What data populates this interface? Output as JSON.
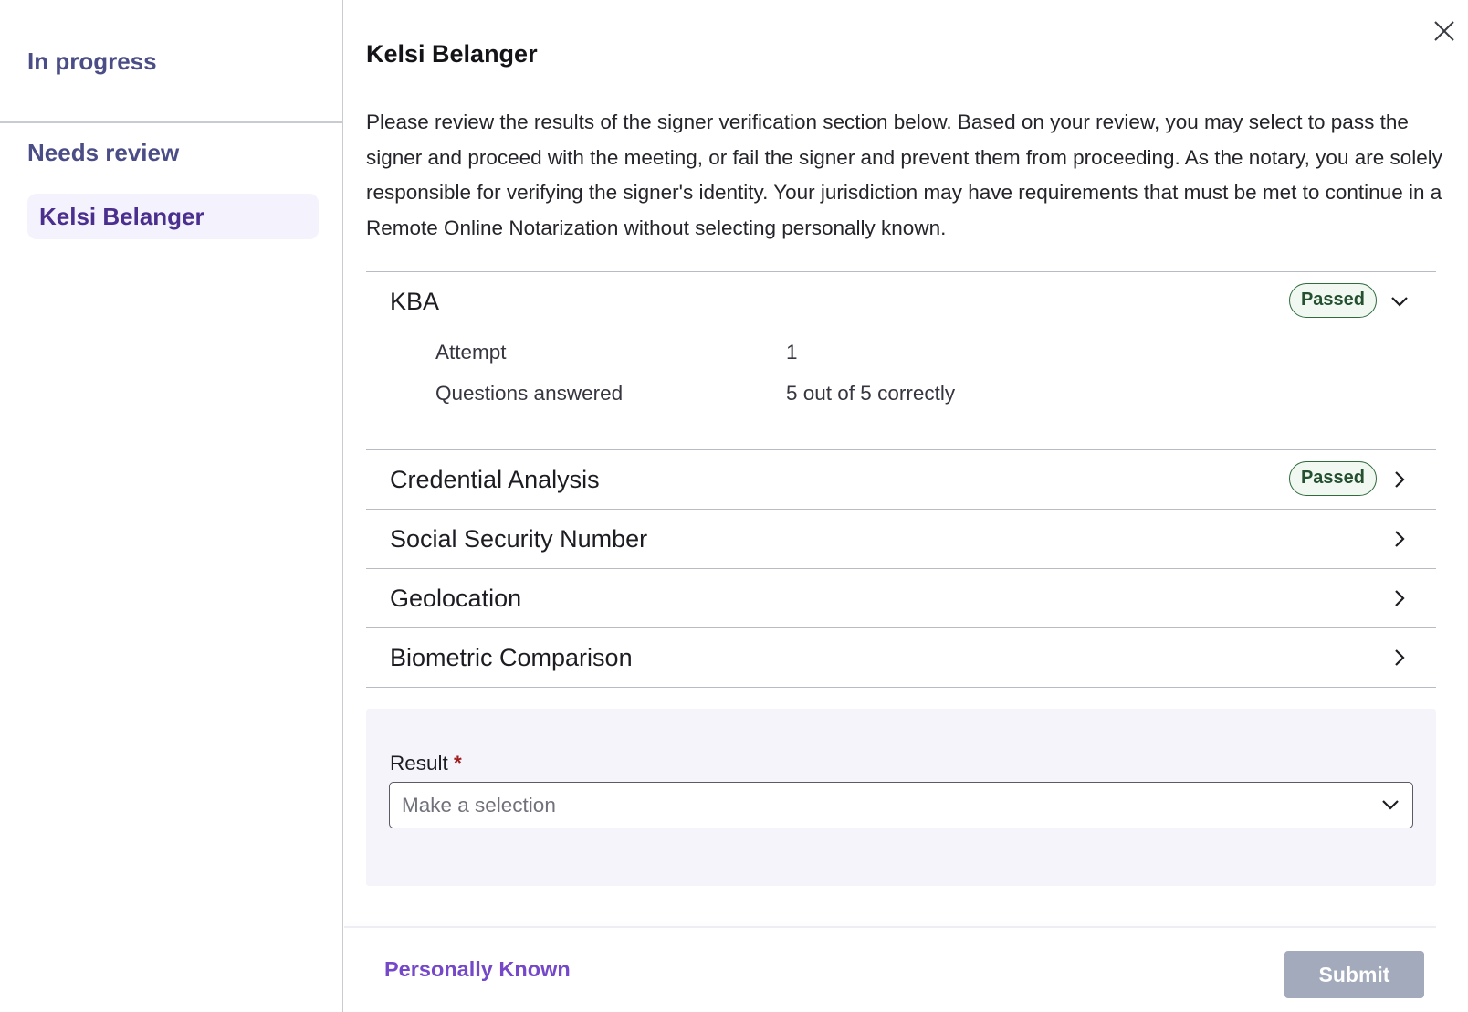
{
  "sidebar": {
    "sections": [
      {
        "title": "In progress",
        "items": []
      },
      {
        "title": "Needs review",
        "items": [
          {
            "label": "Kelsi Belanger",
            "selected": true
          }
        ]
      }
    ]
  },
  "modal": {
    "title": "Kelsi Belanger",
    "close_icon": "close-icon",
    "description": "Please review the results of the signer verification section below. Based on your review, you may select to pass the signer and proceed with the meeting, or fail the signer and prevent them from proceeding. As the notary, you are solely responsible for verifying the signer's identity. Your jurisdiction may have requirements that must be met to continue in a Remote Online Notarization without selecting personally known."
  },
  "sections": [
    {
      "title": "KBA",
      "badge": "Passed",
      "expanded": true,
      "details": [
        {
          "label": "Attempt",
          "value": "1"
        },
        {
          "label": "Questions answered",
          "value": "5 out of 5 correctly"
        }
      ]
    },
    {
      "title": "Credential Analysis",
      "badge": "Passed",
      "expanded": false
    },
    {
      "title": "Social Security Number",
      "badge": null,
      "expanded": false
    },
    {
      "title": "Geolocation",
      "badge": null,
      "expanded": false
    },
    {
      "title": "Biometric Comparison",
      "badge": null,
      "expanded": false
    }
  ],
  "result": {
    "label": "Result",
    "required_marker": "*",
    "placeholder": "Make a selection"
  },
  "footer": {
    "personally_known_label": "Personally Known",
    "submit_label": "Submit",
    "submit_disabled": true
  },
  "colors": {
    "sidebar_heading": "#4b4d86",
    "selected_item_text": "#4b2f8f",
    "selected_item_bg": "#f4f2fc",
    "badge_border": "#2f6b3c",
    "link": "#7548c9",
    "submit_disabled_bg": "#a3aabb",
    "panel_bg": "#f5f4fb",
    "required": "#a11c1c"
  }
}
